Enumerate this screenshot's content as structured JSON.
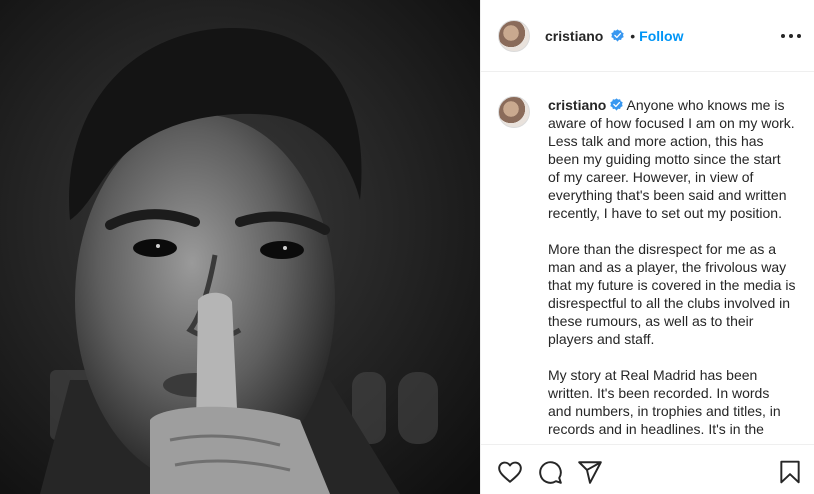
{
  "post": {
    "username": "cristiano",
    "separator": "•",
    "follow_label": "Follow",
    "caption_paragraphs": [
      "Anyone who knows me is aware of how focused I am on my work. Less talk and more action, this has been my guiding motto since the start of my career. However, in view of everything that's been said and written recently, I have to set out my position.",
      "More than the disrespect for me as a man and as a player, the frivolous way that my future is covered in the media is disrespectful to all the clubs involved in these rumours, as well as to their players and staff.",
      "My story at Real Madrid has been written. It's been recorded. In words and numbers, in trophies and titles, in records and in headlines. It's in the"
    ]
  },
  "icons": {
    "verified": "verified-badge-icon",
    "more": "more-options-icon",
    "like": "heart-icon",
    "comment": "comment-icon",
    "share": "share-icon",
    "save": "bookmark-icon"
  },
  "colors": {
    "accent": "#0095f6",
    "text": "#262626",
    "border": "#efefef"
  }
}
